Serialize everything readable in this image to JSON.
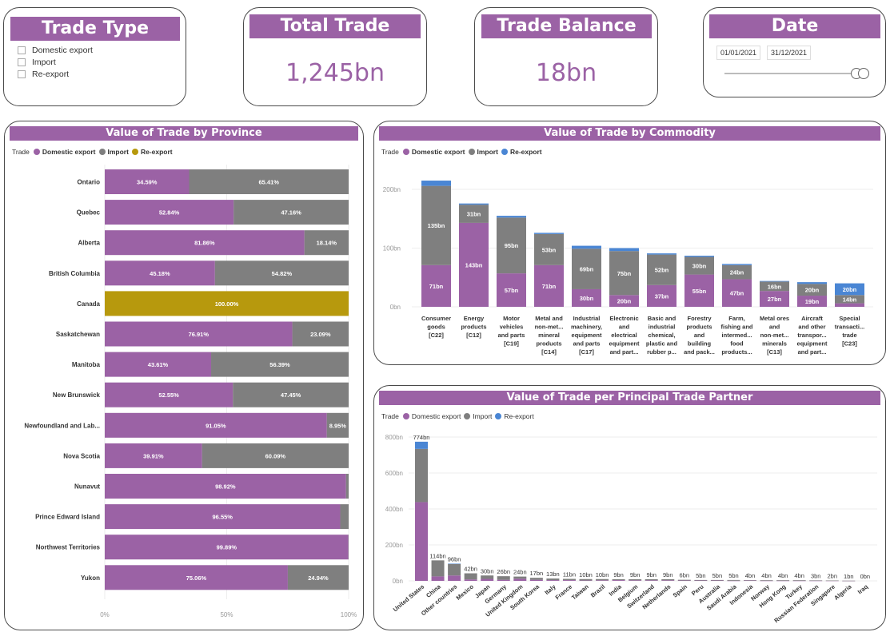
{
  "colors": {
    "domestic": "#9b62a5",
    "import": "#7f7f7f",
    "reexport": "#4a86d4",
    "canada": "#b7990d",
    "accent": "#9b62a5"
  },
  "slicer": {
    "title": "Trade Type",
    "items": [
      "Domestic export",
      "Import",
      "Re-export"
    ]
  },
  "kpi_total": {
    "title": "Total Trade",
    "value": "1,245bn"
  },
  "kpi_balance": {
    "title": "Trade Balance",
    "value": "18bn"
  },
  "date_filter": {
    "title": "Date",
    "start": "01/01/2021",
    "end": "31/12/2021"
  },
  "legend": {
    "heading": "Trade",
    "domestic": "Domestic export",
    "import": "Import",
    "reexport": "Re-export"
  },
  "chart_data": [
    {
      "type": "bar",
      "orientation": "horizontal-100%-stacked",
      "title": "Value of Trade by Province",
      "categories": [
        "Ontario",
        "Quebec",
        "Alberta",
        "British Columbia",
        "Canada",
        "Saskatchewan",
        "Manitoba",
        "New Brunswick",
        "Newfoundland and Lab...",
        "Nova Scotia",
        "Nunavut",
        "Prince Edward Island",
        "Northwest Territories",
        "Yukon"
      ],
      "series": [
        {
          "name": "Domestic export",
          "values": [
            34.59,
            52.84,
            81.86,
            45.18,
            0,
            76.91,
            43.61,
            52.55,
            91.05,
            39.91,
            98.92,
            96.55,
            99.89,
            75.06
          ],
          "labels": [
            "34.59%",
            "52.84%",
            "81.86%",
            "45.18%",
            "",
            "76.91%",
            "43.61%",
            "52.55%",
            "91.05%",
            "39.91%",
            "98.92%",
            "96.55%",
            "",
            ""
          ]
        },
        {
          "name": "Import",
          "values": [
            65.41,
            47.16,
            18.14,
            54.82,
            0,
            23.09,
            56.39,
            47.45,
            8.95,
            60.09,
            1.08,
            3.45,
            0.11,
            24.94
          ],
          "labels": [
            "65.41%",
            "47.16%",
            "18.14%",
            "54.82%",
            "",
            "23.09%",
            "56.39%",
            "47.45%",
            "8.95%",
            "60.09%",
            "",
            "",
            "",
            "24.94%"
          ]
        },
        {
          "name": "Re-export",
          "values": [
            0,
            0,
            0,
            0,
            100,
            0,
            0,
            0,
            0,
            0,
            0,
            0,
            0,
            0
          ],
          "labels": [
            "",
            "",
            "",
            "",
            "100.00%",
            "",
            "",
            "",
            "",
            "",
            "",
            "",
            "",
            ""
          ]
        }
      ],
      "extra_labels": [
        "",
        "",
        "",
        "",
        "",
        "",
        "",
        "",
        "",
        "",
        "",
        "",
        "99.89%",
        "75.06%"
      ],
      "xticks": [
        "0%",
        "50%",
        "100%"
      ],
      "xlim": [
        0,
        100
      ],
      "grid": true,
      "legend_position": "top-left"
    },
    {
      "type": "bar",
      "orientation": "vertical-stacked",
      "title": "Value of Trade by Commodity",
      "categories": [
        [
          "Consumer",
          "goods",
          "[C22]"
        ],
        [
          "Energy",
          "products",
          "[C12]"
        ],
        [
          "Motor",
          "vehicles",
          "and parts",
          "[C19]"
        ],
        [
          "Metal and",
          "non-met...",
          "mineral",
          "products",
          "[C14]"
        ],
        [
          "Industrial",
          "machinery,",
          "equipment",
          "and parts",
          "[C17]"
        ],
        [
          "Electronic",
          "and",
          "electrical",
          "equipment",
          "and part..."
        ],
        [
          "Basic and",
          "industrial",
          "chemical,",
          "plastic and",
          "rubber p..."
        ],
        [
          "Forestry",
          "products",
          "and",
          "building",
          "and pack..."
        ],
        [
          "Farm,",
          "fishing and",
          "intermed...",
          "food",
          "products..."
        ],
        [
          "Metal ores",
          "and",
          "non-met...",
          "minerals",
          "[C13]"
        ],
        [
          "Aircraft",
          "and other",
          "transpor...",
          "equipment",
          "and part..."
        ],
        [
          "Special",
          "transacti...",
          "trade",
          "[C23]"
        ]
      ],
      "series": [
        {
          "name": "Domestic export",
          "values": [
            71,
            143,
            57,
            71,
            30,
            20,
            37,
            55,
            47,
            27,
            19,
            6
          ],
          "labels": [
            "71bn",
            "143bn",
            "57bn",
            "71bn",
            "30bn",
            "20bn",
            "37bn",
            "55bn",
            "47bn",
            "27bn",
            "19bn",
            ""
          ]
        },
        {
          "name": "Import",
          "values": [
            135,
            31,
            95,
            53,
            69,
            75,
            52,
            30,
            24,
            16,
            20,
            14
          ],
          "labels": [
            "135bn",
            "31bn",
            "95bn",
            "53bn",
            "69bn",
            "75bn",
            "52bn",
            "30bn",
            "24bn",
            "16bn",
            "20bn",
            "14bn"
          ]
        },
        {
          "name": "Re-export",
          "values": [
            9,
            2,
            3,
            2,
            5,
            5,
            2,
            2,
            2,
            1,
            3,
            20
          ],
          "labels": [
            "",
            "",
            "",
            "",
            "",
            "",
            "",
            "",
            "",
            "",
            "",
            "20bn"
          ]
        }
      ],
      "yticks": [
        0,
        100,
        200
      ],
      "ytick_labels": [
        "0bn",
        "100bn",
        "200bn"
      ],
      "ylim": [
        0,
        230
      ],
      "legend_position": "top-left"
    },
    {
      "type": "bar",
      "orientation": "vertical-stacked",
      "title": "Value of Trade per Principal Trade Partner",
      "categories": [
        "United States",
        "China",
        "Other countries",
        "Mexico",
        "Japan",
        "Germany",
        "United Kingdom",
        "South Korea",
        "Italy",
        "France",
        "Taiwan",
        "Brazil",
        "India",
        "Belgium",
        "Switzerland",
        "Netherlands",
        "Spain",
        "Peru",
        "Australia",
        "Saudi Arabia",
        "Indonesia",
        "Norway",
        "Hong Kong",
        "Turkey",
        "Russian Federation",
        "Singapore",
        "Algeria",
        "Iraq"
      ],
      "totals": [
        "774bn",
        "114bn",
        "96bn",
        "42bn",
        "30bn",
        "26bn",
        "24bn",
        "17bn",
        "13bn",
        "11bn",
        "10bn",
        "10bn",
        "9bn",
        "9bn",
        "9bn",
        "9bn",
        "6bn",
        "5bn",
        "5bn",
        "5bn",
        "4bn",
        "4bn",
        "4bn",
        "4bn",
        "3bn",
        "2bn",
        "1bn",
        "0bn"
      ],
      "series": [
        {
          "name": "Domestic export",
          "values": [
            438,
            25,
            30,
            8,
            11,
            6,
            12,
            6,
            4,
            4,
            2,
            3,
            4,
            3,
            3,
            3,
            2,
            2,
            2,
            1,
            2,
            1,
            1,
            1,
            1,
            1,
            0.5,
            0
          ]
        },
        {
          "name": "Import",
          "values": [
            296,
            89,
            64,
            34,
            19,
            20,
            12,
            11,
            9,
            7,
            8,
            7,
            5,
            6,
            6,
            6,
            4,
            3,
            3,
            4,
            2,
            3,
            3,
            3,
            2,
            1,
            0.5,
            0
          ]
        },
        {
          "name": "Re-export",
          "values": [
            40,
            0,
            2,
            0,
            0,
            0,
            0,
            0,
            0,
            0,
            0,
            0,
            0,
            0,
            0,
            0,
            0,
            0,
            0,
            0,
            0,
            0,
            0,
            0,
            0,
            0,
            0,
            0
          ]
        }
      ],
      "yticks": [
        0,
        200,
        400,
        600,
        800
      ],
      "ytick_labels": [
        "0bn",
        "200bn",
        "400bn",
        "600bn",
        "800bn"
      ],
      "ylim": [
        0,
        800
      ],
      "legend_position": "top-left"
    }
  ]
}
